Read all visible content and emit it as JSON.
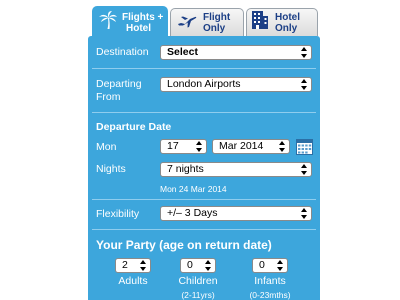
{
  "tabs": [
    {
      "label_1": "Flights +",
      "label_2": "Hotel",
      "icon": "palm-tree-icon",
      "active": true
    },
    {
      "label_1": "Flight",
      "label_2": "Only",
      "icon": "airplane-icon",
      "active": false
    },
    {
      "label_1": "Hotel",
      "label_2": "Only",
      "icon": "hotel-building-icon",
      "active": false
    }
  ],
  "form": {
    "destination": {
      "label": "Destination",
      "value": "Select"
    },
    "departing": {
      "label_1": "Departing",
      "label_2": "From",
      "value": "London Airports"
    },
    "departure_date": {
      "heading": "Departure Date",
      "month_label": "Mon",
      "day_value": "17",
      "month_value": "Mar 2014",
      "calendar_icon": "calendar-icon",
      "nights_label": "Nights",
      "nights_value": "7 nights",
      "return_text": "Mon 24 Mar 2014"
    },
    "flexibility": {
      "label": "Flexibility",
      "value": "+/– 3 Days"
    },
    "party": {
      "heading": "Your Party (age on return date)",
      "adults": {
        "value": "2",
        "label": "Adults"
      },
      "children": {
        "value": "0",
        "label": "Children",
        "sublabel": "(2-11yrs)"
      },
      "infants": {
        "value": "0",
        "label": "Infants",
        "sublabel": "(0-23mths)"
      }
    }
  },
  "colors": {
    "panel": "#3da6dc",
    "tab_text": "#1c3f86",
    "separator": "#8fcdee"
  }
}
